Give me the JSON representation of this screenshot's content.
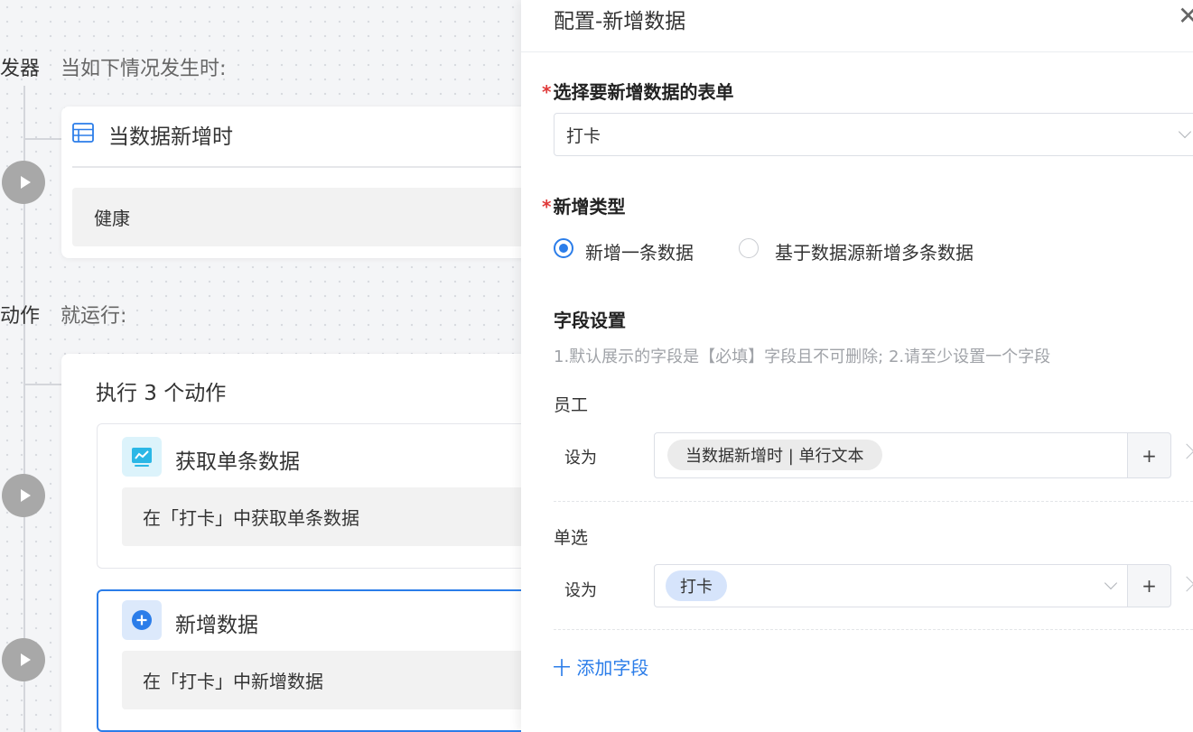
{
  "canvas": {
    "trigger": {
      "section_title": "发器",
      "section_desc": "当如下情况发生时:",
      "card_title": "当数据新增时",
      "card_body": "健康"
    },
    "action": {
      "section_title": "动作",
      "section_desc": "就运行:",
      "group_title": "执行 3 个动作",
      "items": [
        {
          "title": "获取单条数据",
          "body": "在「打卡」中获取单条数据",
          "icon": "chart-icon",
          "color": "#2bb7e6"
        },
        {
          "title": "新增数据",
          "body": "在「打卡」中新增数据",
          "icon": "plus-circle-icon",
          "color": "#2b7de9"
        }
      ]
    }
  },
  "drawer": {
    "title": "配置-新增数据",
    "close_icon": "close-icon",
    "form_select": {
      "required_mark": "*",
      "label": "选择要新增数据的表单",
      "value": "打卡"
    },
    "add_type": {
      "required_mark": "*",
      "label": "新增类型",
      "options": [
        {
          "label": "新增一条数据",
          "selected": true
        },
        {
          "label": "基于数据源新增多条数据",
          "selected": false
        }
      ]
    },
    "fields": {
      "title": "字段设置",
      "hint": "1.默认展示的字段是【必填】字段且不可删除; 2.请至少设置一个字段",
      "rows": [
        {
          "name": "员工",
          "set_as": "设为",
          "tag": "当数据新增时 | 单行文本",
          "plus": "+"
        },
        {
          "name": "单选",
          "set_as": "设为",
          "tag": "打卡",
          "plus": "+"
        }
      ],
      "add_label": "十 添加字段"
    },
    "accent": "#2b7de9"
  }
}
